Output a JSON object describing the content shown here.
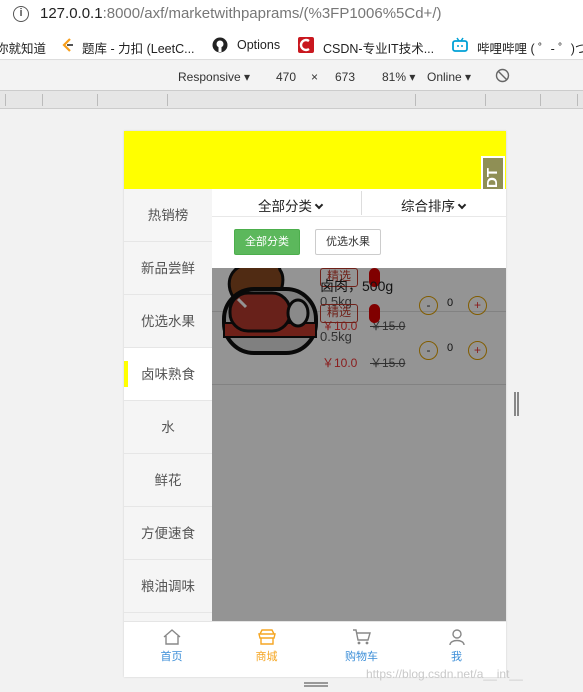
{
  "browser": {
    "url_host": "127.0.0.1",
    "url_rest": ":8000/axf/marketwithpaprams/(%3FP1006%5Cd+/)",
    "bookmarks": [
      {
        "label": "你就知道"
      },
      {
        "label": "题库 - 力扣 (LeetC..."
      },
      {
        "label": "Options"
      },
      {
        "label": "CSDN-专业IT技术..."
      },
      {
        "label": "哔哩哔哩 ( ゜- ゜)つ..."
      }
    ]
  },
  "devtools": {
    "device": "Responsive",
    "width_value": "470",
    "times": "×",
    "height_value": "673",
    "zoom": "81%",
    "network": "Online"
  },
  "app": {
    "dev_badge": "DjDT",
    "sort": {
      "all_categories": "全部分类",
      "overall_sort": "综合排序"
    },
    "filters": [
      {
        "label": "全部分类",
        "active": true
      },
      {
        "label": "优选水果",
        "active": false
      }
    ],
    "sidebar": [
      {
        "label": "热销榜",
        "active": false
      },
      {
        "label": "新品尝鲜",
        "active": false
      },
      {
        "label": "优选水果",
        "active": false
      },
      {
        "label": "卤味熟食",
        "active": true
      },
      {
        "label": "水",
        "active": false
      },
      {
        "label": "鲜花",
        "active": false
      },
      {
        "label": "方便速食",
        "active": false
      },
      {
        "label": "粮油调味",
        "active": false
      }
    ],
    "products": [
      {
        "name": "",
        "tag": "精选",
        "spec": "0.5kg",
        "price": "￥10.0",
        "market_price": "￥15.0",
        "qty": "0",
        "minus": "-",
        "plus": "+"
      },
      {
        "name": "卤肉，500g",
        "tag": "精选",
        "spec": "0.5kg",
        "price": "￥10.0",
        "market_price": "￥15.0",
        "qty": "0",
        "minus": "-",
        "plus": "+"
      }
    ],
    "tabs": [
      {
        "label": "首页",
        "icon": "home-icon",
        "color": "#3b8ed8"
      },
      {
        "label": "商城",
        "icon": "store-icon",
        "color": "#f5a623"
      },
      {
        "label": "购物车",
        "icon": "cart-icon",
        "color": "#3b8ed8"
      },
      {
        "label": "我",
        "icon": "user-icon",
        "color": "#3b8ed8"
      }
    ],
    "accent_yellow": "#ffff00"
  },
  "watermark": "https://blog.csdn.net/a__int__"
}
